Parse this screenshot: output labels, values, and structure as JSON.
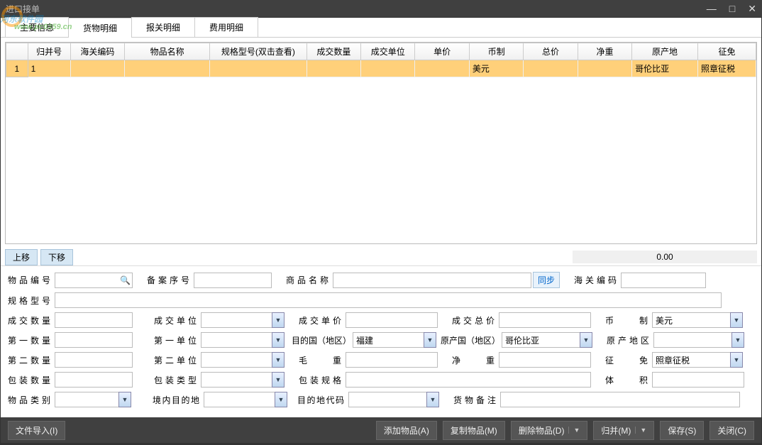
{
  "window": {
    "title": "进口接单"
  },
  "watermark": {
    "main": "河东软件园",
    "sub": "www.pc0359.cn"
  },
  "tabs": [
    {
      "label": "主要信息"
    },
    {
      "label": "货物明细"
    },
    {
      "label": "报关明细"
    },
    {
      "label": "费用明细"
    }
  ],
  "grid": {
    "columns": [
      "归并号",
      "海关编码",
      "物品名称",
      "规格型号(双击查看)",
      "成交数量",
      "成交单位",
      "单价",
      "币制",
      "总价",
      "净重",
      "原产地",
      "征免"
    ],
    "rows": [
      {
        "idx": "1",
        "cells": [
          "1",
          "",
          "",
          "",
          "",
          "",
          "",
          "美元",
          "",
          "",
          "哥伦比亚",
          "照章征税"
        ]
      }
    ]
  },
  "mid": {
    "up": "上移",
    "down": "下移",
    "total": "0.00"
  },
  "form": {
    "r1": {
      "l1": "物品编号",
      "v1": "",
      "l2": "备案序号",
      "v2": "",
      "l3": "商品名称",
      "v3": "",
      "sync": "同步",
      "l4": "海关编码",
      "v4": ""
    },
    "r2": {
      "l1": "规格型号",
      "v1": ""
    },
    "r3": {
      "l1": "成交数量",
      "v1": "",
      "l2": "成交单位",
      "v2": "",
      "l3": "成交单价",
      "v3": "",
      "l4": "成交总价",
      "v4": "",
      "l5": "币　　制",
      "v5": "美元"
    },
    "r4": {
      "l1": "第一数量",
      "v1": "",
      "l2": "第一单位",
      "v2": "",
      "l3": "目的国（地区）",
      "v3": "福建",
      "l4": "原产国（地区）",
      "v4": "哥伦比亚",
      "l5": "原产地区",
      "v5": ""
    },
    "r5": {
      "l1": "第二数量",
      "v1": "",
      "l2": "第二单位",
      "v2": "",
      "l3": "毛　　重",
      "v3": "",
      "l4": "净　　重",
      "v4": "",
      "l5": "征　　免",
      "v5": "照章征税"
    },
    "r6": {
      "l1": "包装数量",
      "v1": "",
      "l2": "包装类型",
      "v2": "",
      "l3": "包装规格",
      "v3": "",
      "l5": "体　　积",
      "v5": ""
    },
    "r7": {
      "l1": "物品类别",
      "v1": "",
      "l2": "境内目的地",
      "v2": "",
      "l3": "目的地代码",
      "v3": "",
      "l4": "货物备注",
      "v4": ""
    }
  },
  "footer": {
    "import": "文件导入(I)",
    "add": "添加物品(A)",
    "copy": "复制物品(M)",
    "del": "删除物品(D)",
    "merge": "归并(M)",
    "save": "保存(S)",
    "close": "关闭(C)"
  }
}
